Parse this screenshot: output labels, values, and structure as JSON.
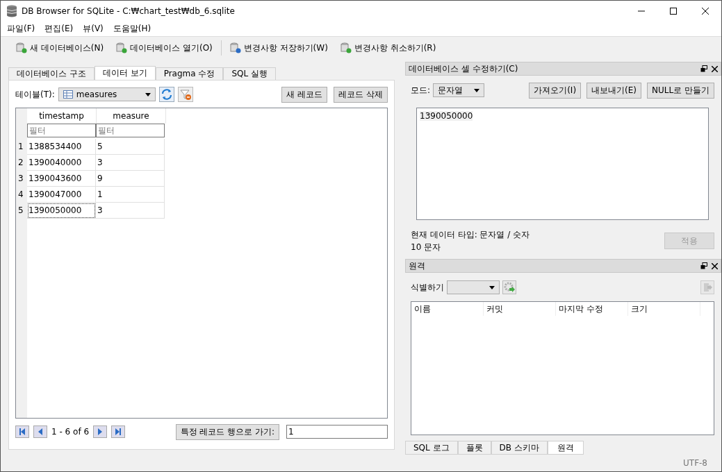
{
  "window": {
    "title": "DB Browser for SQLite - C:₩chart_test₩db_6.sqlite"
  },
  "menu": [
    {
      "label": "파일(F)"
    },
    {
      "label": "편집(E)"
    },
    {
      "label": "뷰(V)"
    },
    {
      "label": "도움말(H)"
    }
  ],
  "toolbar": [
    {
      "kind": "new",
      "label": "새 데이터베이스(N)"
    },
    {
      "kind": "open",
      "label": "데이터베이스 열기(O)"
    },
    {
      "kind": "save",
      "label": "변경사항 저장하기(W)"
    },
    {
      "kind": "revert",
      "label": "변경사항 취소하기(R)"
    }
  ],
  "tabs": [
    {
      "label": "데이터베이스 구조",
      "selected": false
    },
    {
      "label": "데이터 보기",
      "selected": true
    },
    {
      "label": "Pragma 수정",
      "selected": false
    },
    {
      "label": "SQL 실행",
      "selected": false
    }
  ],
  "browse": {
    "table_label": "테이블(T):",
    "table_value": "measures",
    "buttons": [
      "새 레코드",
      "레코드 삭제"
    ],
    "columns": [
      {
        "name": "timestamp",
        "filter_placeholder": "필터"
      },
      {
        "name": "measure",
        "filter_placeholder": "필터"
      }
    ],
    "rows": [
      {
        "number": "1",
        "cells": [
          "1388534400",
          "5"
        ],
        "selected": false
      },
      {
        "number": "2",
        "cells": [
          "1390040000",
          "3"
        ],
        "selected": false
      },
      {
        "number": "3",
        "cells": [
          "1390043600",
          "9"
        ],
        "selected": false
      },
      {
        "number": "4",
        "cells": [
          "1390047000",
          "1"
        ],
        "selected": false
      },
      {
        "number": "5",
        "cells": [
          "1390050000",
          "3"
        ],
        "selected": true
      }
    ],
    "pager": "1 - 6 of 6",
    "goto_button": "특정 레코드 행으로 가기:",
    "goto_value": "1"
  },
  "edit_cell": {
    "title": "데이터베이스 셀 수정하기(C)",
    "mode_label": "모드:",
    "mode_value": "문자열",
    "buttons": [
      "가져오기(I)",
      "내보내기(E)",
      "NULL로 만들기"
    ],
    "value": "1390050000",
    "type_text": "현재 데이터 타입: 문자열 / 숫자",
    "size_text": "10 문자",
    "apply": {
      "label": "적용",
      "disabled": true
    }
  },
  "remote": {
    "title": "원격",
    "identity_label": "식별하기",
    "columns": [
      "이름",
      "커밋",
      "마지막 수정",
      "크기"
    ]
  },
  "bottom_tabs": [
    {
      "label": "SQL 로그",
      "selected": false
    },
    {
      "label": "플롯",
      "selected": false
    },
    {
      "label": "DB 스키마",
      "selected": false
    },
    {
      "label": "원격",
      "selected": true
    }
  ],
  "status_bar": {
    "encoding": "UTF-8"
  }
}
